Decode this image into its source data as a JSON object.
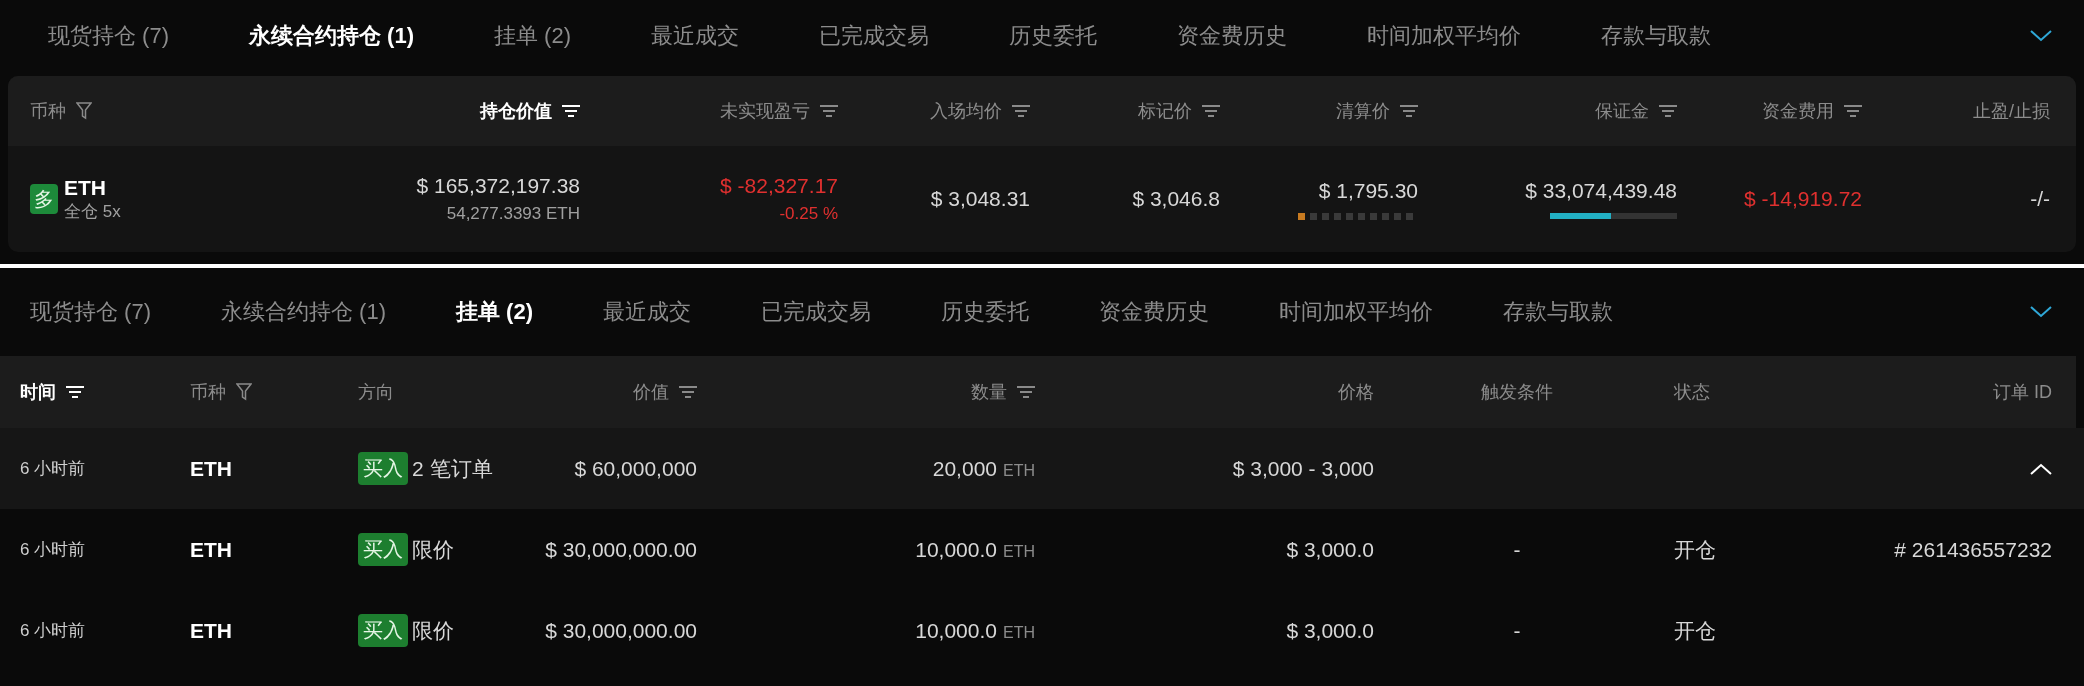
{
  "positions_panel": {
    "tabs": [
      {
        "label": "现货持仓 (7)",
        "selected": false
      },
      {
        "label": "永续合约持仓 (1)",
        "selected": true
      },
      {
        "label": "挂单 (2)",
        "selected": false
      },
      {
        "label": "最近成交",
        "selected": false
      },
      {
        "label": "已完成交易",
        "selected": false
      },
      {
        "label": "历史委托",
        "selected": false
      },
      {
        "label": "资金费历史",
        "selected": false
      },
      {
        "label": "时间加权平均价",
        "selected": false
      },
      {
        "label": "存款与取款",
        "selected": false
      }
    ],
    "columns": [
      {
        "label": "币种",
        "kind": "filter",
        "selected": false
      },
      {
        "label": "持仓价值",
        "kind": "sort",
        "selected": true
      },
      {
        "label": "未实现盈亏",
        "kind": "sort",
        "selected": false
      },
      {
        "label": "入场均价",
        "kind": "sort",
        "selected": false
      },
      {
        "label": "标记价",
        "kind": "sort",
        "selected": false
      },
      {
        "label": "清算价",
        "kind": "sort",
        "selected": false
      },
      {
        "label": "保证金",
        "kind": "sort",
        "selected": false
      },
      {
        "label": "资金费用",
        "kind": "sort",
        "selected": false
      },
      {
        "label": "止盈/止损",
        "kind": "plain",
        "selected": false
      }
    ],
    "position": {
      "side": "多",
      "symbol": "ETH",
      "margin_mode": "全仓 5x",
      "value": "$ 165,372,197.38",
      "size": "54,277.3393 ETH",
      "pnl": {
        "text": "$ -82,327.17",
        "negative": true
      },
      "pnl_pct": {
        "text": "-0.25 %",
        "negative": true
      },
      "entry_price": "$ 3,048.31",
      "mark_price": "$ 3,046.8",
      "liq_price": "$ 1,795.30",
      "liq_risk": {
        "level": 0.1
      },
      "margin": "$ 33,074,439.48",
      "margin_bar": {
        "level": 0.48
      },
      "funding_fee": {
        "text": "$ -14,919.72",
        "negative": true
      },
      "tp_sl": "-/-"
    }
  },
  "orders_panel": {
    "tabs": [
      {
        "label": "现货持仓 (7)",
        "selected": false
      },
      {
        "label": "永续合约持仓 (1)",
        "selected": false
      },
      {
        "label": "挂单 (2)",
        "selected": true
      },
      {
        "label": "最近成交",
        "selected": false
      },
      {
        "label": "已完成交易",
        "selected": false
      },
      {
        "label": "历史委托",
        "selected": false
      },
      {
        "label": "资金费历史",
        "selected": false
      },
      {
        "label": "时间加权平均价",
        "selected": false
      },
      {
        "label": "存款与取款",
        "selected": false
      }
    ],
    "columns": [
      {
        "label": "时间",
        "kind": "sort",
        "selected": true
      },
      {
        "label": "币种",
        "kind": "filter",
        "selected": false
      },
      {
        "label": "方向",
        "kind": "plain",
        "selected": false
      },
      {
        "label": "价值",
        "kind": "sort",
        "selected": false
      },
      {
        "label": "数量",
        "kind": "sort",
        "selected": false
      },
      {
        "label": "价格",
        "kind": "plain",
        "selected": false
      },
      {
        "label": "触发条件",
        "kind": "plain",
        "selected": false
      },
      {
        "label": "状态",
        "kind": "plain",
        "selected": false
      },
      {
        "label": "订单 ID",
        "kind": "plain",
        "selected": false
      }
    ],
    "group": {
      "time": "6 小时前",
      "symbol": "ETH",
      "side": "买入",
      "type": "2 笔订单",
      "value": "$ 60,000,000",
      "qty": "20,000",
      "unit": "ETH",
      "price": "$ 3,000 - 3,000",
      "expanded": true
    },
    "orders": [
      {
        "time": "6 小时前",
        "symbol": "ETH",
        "side": "买入",
        "type": "限价",
        "value": "$ 30,000,000.00",
        "qty": "10,000.0",
        "unit": "ETH",
        "price": "$ 3,000.0",
        "trigger": "-",
        "status": "开仓",
        "order_id": "# 261436557232"
      },
      {
        "time": "6 小时前",
        "symbol": "ETH",
        "side": "买入",
        "type": "限价",
        "value": "$ 30,000,000.00",
        "qty": "10,000.0",
        "unit": "ETH",
        "price": "$ 3,000.0",
        "trigger": "-",
        "status": "开仓"
      }
    ]
  }
}
